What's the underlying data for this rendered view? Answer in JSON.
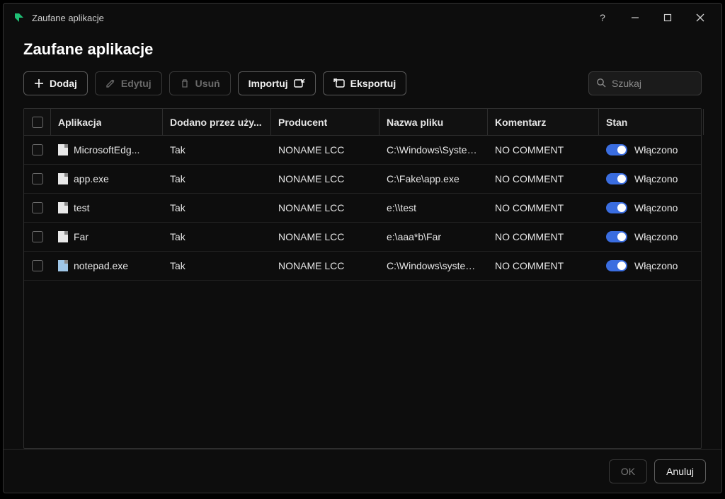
{
  "window": {
    "title": "Zaufane aplikacje"
  },
  "page": {
    "heading": "Zaufane aplikacje"
  },
  "toolbar": {
    "add": "Dodaj",
    "edit": "Edytuj",
    "delete": "Usuń",
    "import": "Importuj",
    "export": "Eksportuj"
  },
  "search": {
    "placeholder": "Szukaj"
  },
  "columns": {
    "app": "Aplikacja",
    "added": "Dodano przez uży...",
    "vendor": "Producent",
    "file": "Nazwa pliku",
    "comment": "Komentarz",
    "state": "Stan"
  },
  "rows": [
    {
      "app": "MicrosoftEdg...",
      "added": "Tak",
      "vendor": "NONAME LCC",
      "file": "C:\\Windows\\System...",
      "comment": "NO COMMENT",
      "state": "Włączono",
      "icon": "file"
    },
    {
      "app": "app.exe",
      "added": "Tak",
      "vendor": "NONAME LCC",
      "file": "C:\\Fake\\app.exe",
      "comment": "NO COMMENT",
      "state": "Włączono",
      "icon": "file"
    },
    {
      "app": "test",
      "added": "Tak",
      "vendor": "NONAME LCC",
      "file": "e:\\\\test",
      "comment": "NO COMMENT",
      "state": "Włączono",
      "icon": "file"
    },
    {
      "app": "Far",
      "added": "Tak",
      "vendor": "NONAME LCC",
      "file": "e:\\aaa*b\\Far",
      "comment": "NO COMMENT",
      "state": "Włączono",
      "icon": "file"
    },
    {
      "app": "notepad.exe",
      "added": "Tak",
      "vendor": "NONAME LCC",
      "file": "C:\\Windows\\system...",
      "comment": "NO COMMENT",
      "state": "Włączono",
      "icon": "notepad"
    }
  ],
  "footer": {
    "ok": "OK",
    "cancel": "Anuluj"
  }
}
